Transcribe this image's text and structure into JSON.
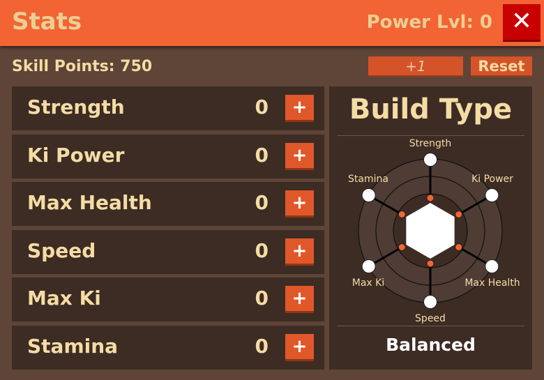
{
  "header": {
    "title": "Stats",
    "power_level": "Power Lvl: 0",
    "close_icon": "close-x-icon"
  },
  "toolbar": {
    "skill_points": "Skill Points: 750",
    "increment": "+1",
    "reset": "Reset"
  },
  "stats": [
    {
      "name": "Strength",
      "value": "0",
      "plus": "+"
    },
    {
      "name": "Ki Power",
      "value": "0",
      "plus": "+"
    },
    {
      "name": "Max Health",
      "value": "0",
      "plus": "+"
    },
    {
      "name": "Speed",
      "value": "0",
      "plus": "+"
    },
    {
      "name": "Max Ki",
      "value": "0",
      "plus": "+"
    },
    {
      "name": "Stamina",
      "value": "0",
      "plus": "+"
    }
  ],
  "build": {
    "title": "Build Type",
    "result": "Balanced",
    "axes": [
      "Strength",
      "Ki Power",
      "Max Health",
      "Speed",
      "Max Ki",
      "Stamina"
    ],
    "colors": {
      "accent": "#f36434",
      "close": "#c90000",
      "panel": "#3d2c24"
    }
  }
}
